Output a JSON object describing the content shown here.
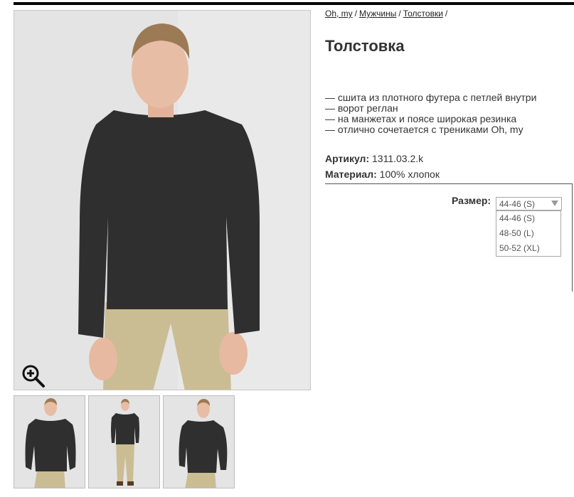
{
  "breadcrumb": [
    {
      "label": "Oh, my"
    },
    {
      "label": "Мужчины"
    },
    {
      "label": "Толстовки"
    }
  ],
  "product": {
    "title": "Толстовка",
    "features": [
      "— сшита из плотного футера с петлей внутри",
      "— ворот реглан",
      "— на манжетах и поясе широкая резинка",
      "— отлично сочетается с трениками Oh, my"
    ],
    "article_label": "Артикул:",
    "article_value": "1311.03.2.k",
    "material_label": "Материал:",
    "material_value": "100% хлопок"
  },
  "size": {
    "label": "Размер:",
    "selected": "44-46 (S)",
    "options": [
      "44-46 (S)",
      "48-50 (L)",
      "50-52 (XL)"
    ]
  },
  "icons": {
    "zoom": "zoom-in-icon",
    "dropdown": "chevron-down-icon"
  },
  "colors": {
    "sweater": "#2f2f2f",
    "trousers": "#cbbd93",
    "background": "#e3e3e3"
  }
}
